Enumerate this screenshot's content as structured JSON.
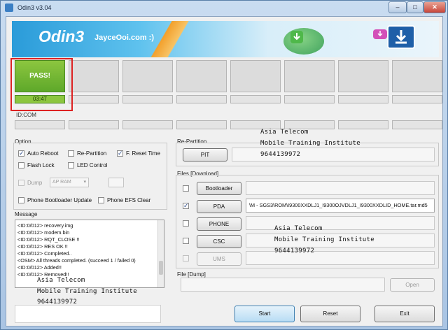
{
  "window": {
    "title": "Odin3 v3.04",
    "min": "–",
    "max": "□",
    "close": "✕"
  },
  "banner": {
    "logo": "Odin3",
    "subtitle": "JayceOoi.com :)"
  },
  "slots": {
    "status": "PASS!",
    "timer": "03:47",
    "id_label": "ID:COM"
  },
  "option": {
    "title": "Option",
    "auto_reboot": "Auto Reboot",
    "re_partition": "Re-Partition",
    "f_reset_time": "F. Reset Time",
    "flash_lock": "Flash Lock",
    "led_control": "LED Control",
    "dump": "Dump",
    "dump_select": "AP RAM",
    "phone_bootloader_update": "Phone Bootloader Update",
    "phone_efs_clear": "Phone EFS Clear"
  },
  "message": {
    "title": "Message",
    "lines": [
      "<ID:0/012> recovery.img",
      "<ID:0/012> modem.bin",
      "<ID:0/012> RQT_CLOSE !!",
      "<ID:0/012> RES OK !!",
      "<ID:0/012> Completed..",
      "<OSM> All threads completed. (succeed 1 / failed 0)",
      "<ID:0/012> Added!!",
      "<ID:0/012> Removed!!"
    ]
  },
  "repartition": {
    "title": "Re-Partition",
    "pit": "PIT"
  },
  "files": {
    "title": "Files [Download]",
    "bootloader": "Bootloader",
    "pda": "PDA",
    "pda_path": "\\M - SGS3\\ROM\\I9300XXDLJ1_I9300OJVDLJ1_I9300XXDLID_HOME.tar.md5",
    "phone": "PHONE",
    "csc": "CSC",
    "ums": "UMS"
  },
  "dump": {
    "title": "File [Dump]",
    "open": "Open"
  },
  "buttons": {
    "start": "Start",
    "reset": "Reset",
    "exit": "Exit"
  },
  "watermark": {
    "line1": "Asia Telecom",
    "line2": "Mobile Training Institute",
    "line3": "9644139972"
  }
}
